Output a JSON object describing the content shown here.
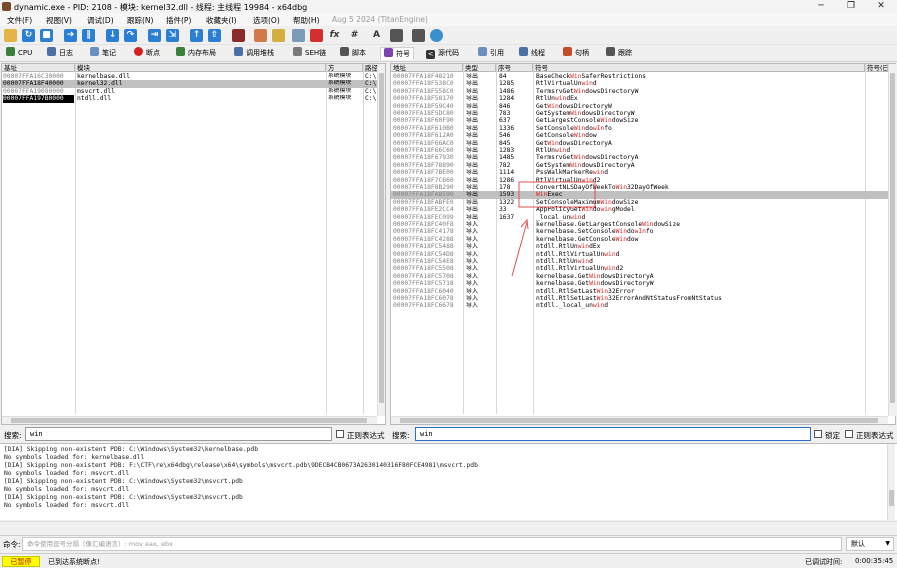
{
  "window": {
    "title": "dynamic.exe - PID: 2108 - 模块: kernel32.dll - 线程: 主线程 19984 - x64dbg",
    "minimize": "─",
    "maximize": "❐",
    "close": "✕"
  },
  "menu": {
    "items": [
      "文件(F)",
      "视图(V)",
      "调试(D)",
      "跟踪(N)",
      "插件(P)",
      "收藏夹(I)",
      "选项(O)",
      "帮助(H)"
    ],
    "build_date": "Aug 5 2024 (TitanEngine)"
  },
  "tabs": [
    {
      "label": "CPU",
      "color": "#3a7f3a"
    },
    {
      "label": "日志",
      "color": "#4d6fa8"
    },
    {
      "label": "笔记",
      "color": "#6b8fbf"
    },
    {
      "label": "断点",
      "color": "#d62020"
    },
    {
      "label": "内存布局",
      "color": "#3a7f3a"
    },
    {
      "label": "调用堆栈",
      "color": "#4d6fa8"
    },
    {
      "label": "SEH链",
      "color": "#7a7a7a"
    },
    {
      "label": "脚本",
      "color": "#555555"
    },
    {
      "label": "符号",
      "color": "#7a45b3"
    },
    {
      "label": "源代码",
      "color": "#333333"
    },
    {
      "label": "引用",
      "color": "#6b8fbf"
    },
    {
      "label": "线程",
      "color": "#4d6fa8"
    },
    {
      "label": "句柄",
      "color": "#c44d2a"
    },
    {
      "label": "跟踪",
      "color": "#555555"
    }
  ],
  "selected_tab": "符号",
  "modules": {
    "headers": [
      "基址",
      "模块",
      "方",
      "路径"
    ],
    "rows": [
      {
        "base": "00007FFA16C30000",
        "name": "kernelbase.dll",
        "party": "系统模块",
        "path": "C:\\"
      },
      {
        "base": "00007FFA18F40000",
        "name": "kernel32.dll",
        "party": "系统模块",
        "path": "C:\\"
      },
      {
        "base": "00007FFA19080000",
        "name": "msvcrt.dll",
        "party": "系统模块",
        "path": "C:\\"
      },
      {
        "base": "00007FFA197B0000",
        "name": "ntdll.dll",
        "party": "系统模块",
        "path": "C:\\"
      }
    ]
  },
  "symbols": {
    "headers": [
      "地址",
      "类型",
      "序号",
      "符号",
      "符号(已"
    ],
    "rows": [
      {
        "addr": "00007FFA18F48210",
        "type": "导出",
        "ord": "84",
        "sym": "BaseCheckWinSaferRestrictions"
      },
      {
        "addr": "00007FFA18F538C0",
        "type": "导出",
        "ord": "1285",
        "sym": "RtlVirtualUnwind"
      },
      {
        "addr": "00007FFA18F558C0",
        "type": "导出",
        "ord": "1486",
        "sym": "TermsrvGetWindowsDirectoryW"
      },
      {
        "addr": "00007FFA18F58170",
        "type": "导出",
        "ord": "1284",
        "sym": "RtlUnwindEx"
      },
      {
        "addr": "00007FFA18F59C40",
        "type": "导出",
        "ord": "846",
        "sym": "GetWindowsDirectoryW"
      },
      {
        "addr": "00007FFA18F5DC80",
        "type": "导出",
        "ord": "783",
        "sym": "GetSystemWindowsDirectoryW"
      },
      {
        "addr": "00007FFA18F60F90",
        "type": "导出",
        "ord": "637",
        "sym": "GetLargestConsoleWindowSize"
      },
      {
        "addr": "00007FFA18F610B0",
        "type": "导出",
        "ord": "1336",
        "sym": "SetConsoleWindowInfo"
      },
      {
        "addr": "00007FFA18F612A0",
        "type": "导出",
        "ord": "546",
        "sym": "GetConsoleWindow"
      },
      {
        "addr": "00007FFA18F66AC0",
        "type": "导出",
        "ord": "845",
        "sym": "GetWindowsDirectoryA"
      },
      {
        "addr": "00007FFA18F66C60",
        "type": "导出",
        "ord": "1283",
        "sym": "RtlUnwind"
      },
      {
        "addr": "00007FFA18F67930",
        "type": "导出",
        "ord": "1485",
        "sym": "TermsrvGetWindowsDirectoryA"
      },
      {
        "addr": "00007FFA18F78890",
        "type": "导出",
        "ord": "782",
        "sym": "GetSystemWindowsDirectoryA"
      },
      {
        "addr": "00007FFA18F7BE00",
        "type": "导出",
        "ord": "1114",
        "sym": "PssWalkMarkerRewind"
      },
      {
        "addr": "00007FFA18F7C660",
        "type": "导出",
        "ord": "1286",
        "sym": "RtlVirtualUnwind2"
      },
      {
        "addr": "00007FFA18F8B290",
        "type": "导出",
        "ord": "178",
        "sym": "ConvertNLSDayOfWeekToWin32DayOfWeek"
      },
      {
        "addr": "00007FFA18FA8590",
        "type": "导出",
        "ord": "1593",
        "sym": "WinExec"
      },
      {
        "addr": "00007FFA18FABFE0",
        "type": "导出",
        "ord": "1322",
        "sym": "SetConsoleMaximumWindowSize"
      },
      {
        "addr": "00007FFA18FE2CC4",
        "type": "导出",
        "ord": "33",
        "sym": "AppPolicyGetWindowingModel"
      },
      {
        "addr": "00007FFA18FEC099",
        "type": "导出",
        "ord": "1637",
        "sym": "_local_unwind"
      },
      {
        "addr": "00007FFA18FC40F8",
        "type": "导入",
        "ord": "",
        "sym": "kernelbase.GetLargestConsoleWindowSize"
      },
      {
        "addr": "00007FFA18FC4178",
        "type": "导入",
        "ord": "",
        "sym": "kernelbase.SetConsoleWindowInfo"
      },
      {
        "addr": "00007FFA18FC4288",
        "type": "导入",
        "ord": "",
        "sym": "kernelbase.GetConsoleWindow"
      },
      {
        "addr": "00007FFA18FC5488",
        "type": "导入",
        "ord": "",
        "sym": "ntdll.RtlUnwindEx"
      },
      {
        "addr": "00007FFA18FC54D8",
        "type": "导入",
        "ord": "",
        "sym": "ntdll.RtlVirtualUnwind"
      },
      {
        "addr": "00007FFA18FC54E8",
        "type": "导入",
        "ord": "",
        "sym": "ntdll.RtlUnwind"
      },
      {
        "addr": "00007FFA18FC5508",
        "type": "导入",
        "ord": "",
        "sym": "ntdll.RtlVirtualUnwind2"
      },
      {
        "addr": "00007FFA18FC5708",
        "type": "导入",
        "ord": "",
        "sym": "kernelbase.GetWindowsDirectoryA"
      },
      {
        "addr": "00007FFA18FC5718",
        "type": "导入",
        "ord": "",
        "sym": "kernelbase.GetWindowsDirectoryW"
      },
      {
        "addr": "00007FFA18FC6040",
        "type": "导入",
        "ord": "",
        "sym": "ntdll.RtlSetLastWin32Error"
      },
      {
        "addr": "00007FFA18FC6078",
        "type": "导入",
        "ord": "",
        "sym": "ntdll.RtlSetLastWin32ErrorAndNtStatusFromNtStatus"
      },
      {
        "addr": "00007FFA18FC6678",
        "type": "导入",
        "ord": "",
        "sym": "ntdll._local_unwind"
      }
    ]
  },
  "search": {
    "left_label": "搜索:",
    "left_value": "win",
    "left_regex": "正则表达式",
    "right_label": "搜索:",
    "right_value": "win",
    "lock_label": "锁定",
    "right_regex": "正则表达式"
  },
  "log": [
    "[DIA] Skipping non-existent PDB: C:\\Windows\\System32\\kernelbase.pdb",
    "No symbols loaded for: kernelbase.dll",
    "[DIA] Skipping non-existent PDB: F:\\CTF\\re\\x64dbg\\release\\x64\\symbols\\msvcrt.pdb\\9DECB4CB0673A2630140316F80FCE4981\\msvcrt.pdb",
    "No symbols loaded for: msvcrt.dll",
    "[DIA] Skipping non-existent PDB: C:\\Windows\\System32\\msvcrt.pdb",
    "No symbols loaded for: msvcrt.dll",
    "[DIA] Skipping non-existent PDB: C:\\Windows\\System32\\msvcrt.pdb",
    "No symbols loaded for: msvcrt.dll"
  ],
  "command": {
    "label": "命令:",
    "placeholder": "命令使用逗号分隔（像汇编语言）: mov eax, ebx",
    "mode": "默认"
  },
  "status": {
    "state": "已暂停",
    "message": "已到达系统断点!",
    "elapsed_label": "已调试时间:",
    "elapsed": "0:00:35:45"
  },
  "colors": {
    "accent": "#e02020",
    "paused": "#ffff00",
    "selected_row": "#c0c0c0"
  }
}
